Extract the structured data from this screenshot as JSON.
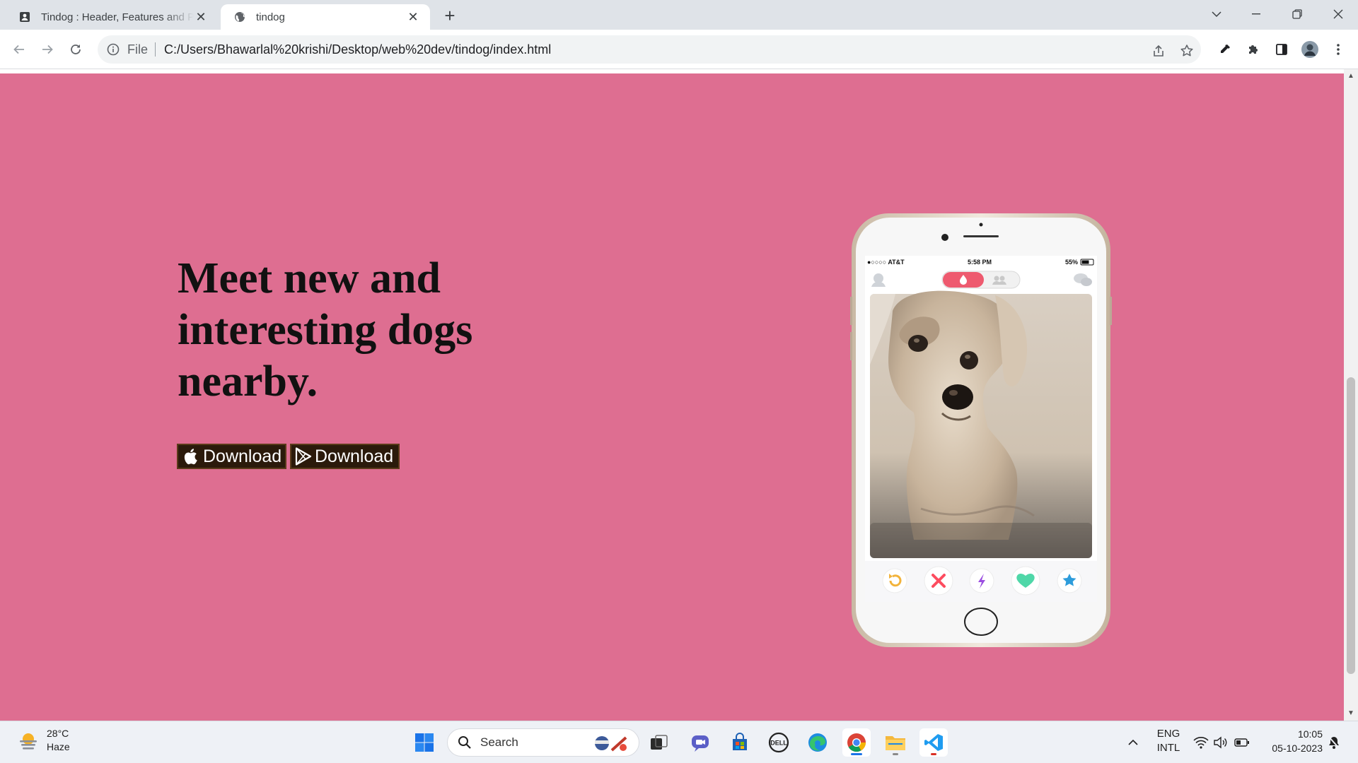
{
  "browser": {
    "tabs": [
      {
        "title": "Tindog : Header, Features and Pricing",
        "active": false,
        "icon": "document-icon"
      },
      {
        "title": "tindog",
        "active": true,
        "icon": "globe-icon"
      }
    ],
    "new_tab_label": "+",
    "address": {
      "scheme_label": "File",
      "url": "C:/Users/Bhawarlal%20krishi/Desktop/web%20dev/tindog/index.html"
    }
  },
  "page": {
    "headline": "Meet new and interesting dogs nearby.",
    "buttons": [
      {
        "label": "Download",
        "icon": "apple-icon"
      },
      {
        "label": "Download",
        "icon": "google-play-icon"
      }
    ],
    "hero_color": "#de6e91",
    "phone": {
      "carrier": "●○○○○ AT&T",
      "time": "5:58 PM",
      "battery": "55%"
    }
  },
  "taskbar": {
    "weather": {
      "temp": "28°C",
      "condition": "Haze"
    },
    "search_placeholder": "Search",
    "language": {
      "line1": "ENG",
      "line2": "INTL"
    },
    "clock": {
      "time": "10:05",
      "date": "05-10-2023"
    }
  }
}
